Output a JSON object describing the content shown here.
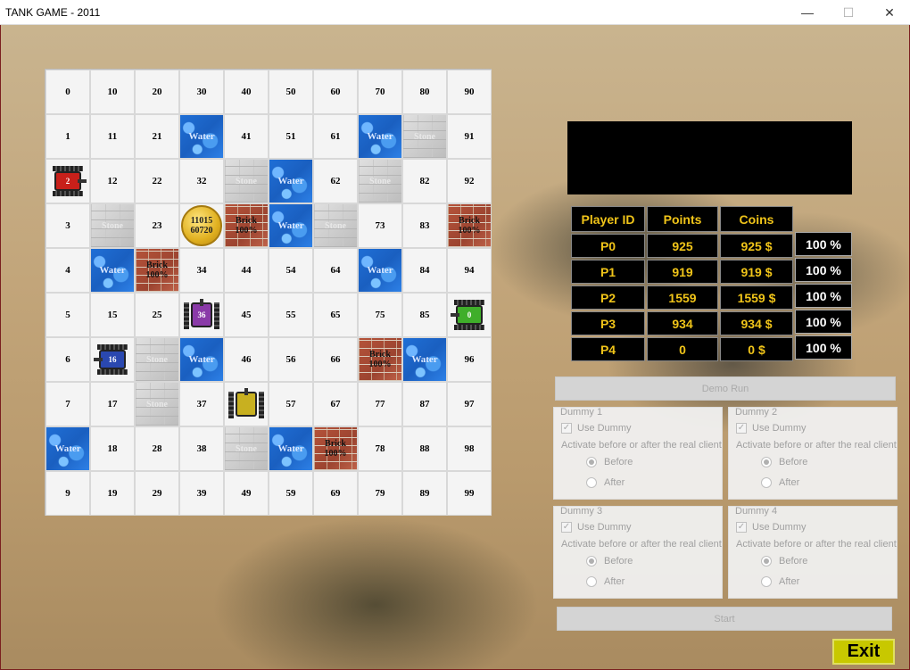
{
  "window": {
    "title": "TANK GAME - 2011",
    "min": "—",
    "max": "☐",
    "close": "✕"
  },
  "board": {
    "cells": [
      [
        "0",
        "10",
        "20",
        "30",
        "40",
        "50",
        "60",
        "70",
        "80",
        "90"
      ],
      [
        "1",
        "11",
        "21",
        "Water",
        "41",
        "51",
        "61",
        "Water",
        "Stone",
        "91"
      ],
      [
        "TANK:2:red:right",
        "12",
        "22",
        "32",
        "Stone",
        "Water",
        "62",
        "Stone",
        "82",
        "92"
      ],
      [
        "3",
        "Stone",
        "23",
        "COIN:11015:60720",
        "Brick:100%",
        "Water",
        "Stone",
        "73",
        "83",
        "Brick:100%"
      ],
      [
        "4",
        "Water",
        "Brick:100%",
        "34",
        "44",
        "54",
        "64",
        "Water",
        "84",
        "94"
      ],
      [
        "5",
        "15",
        "25",
        "TANK:36:purple:up",
        "45",
        "55",
        "65",
        "75",
        "85",
        "TANK:0:green:left"
      ],
      [
        "6",
        "TANK:16:blue:left",
        "Stone",
        "Water",
        "46",
        "56",
        "66",
        "Brick:100%",
        "Water",
        "96"
      ],
      [
        "7",
        "17",
        "Stone",
        "37",
        "TANK:?:yellow:up",
        "57",
        "67",
        "77",
        "87",
        "97"
      ],
      [
        "Water",
        "18",
        "28",
        "38",
        "Stone",
        "Water",
        "Brick:100%",
        "78",
        "88",
        "98"
      ],
      [
        "9",
        "19",
        "29",
        "39",
        "49",
        "59",
        "69",
        "79",
        "89",
        "99"
      ]
    ]
  },
  "scoreboard": {
    "headers": {
      "id": "Player ID",
      "points": "Points",
      "coins": "Coins"
    },
    "rows": [
      {
        "id": "P0",
        "points": "925",
        "coins": "925 $",
        "health": "100 %"
      },
      {
        "id": "P1",
        "points": "919",
        "coins": "919 $",
        "health": "100 %"
      },
      {
        "id": "P2",
        "points": "1559",
        "coins": "1559 $",
        "health": "100 %"
      },
      {
        "id": "P3",
        "points": "934",
        "coins": "934 $",
        "health": "100 %"
      },
      {
        "id": "P4",
        "points": "0",
        "coins": "0 $",
        "health": "100 %"
      }
    ]
  },
  "controls": {
    "demo_run": "Demo Run",
    "use_dummy": "Use Dummy",
    "activate": "Activate before or after the real client",
    "before": "Before",
    "after": "After",
    "dummies": [
      "Dummy 1",
      "Dummy 2",
      "Dummy 3",
      "Dummy 4"
    ],
    "start": "Start",
    "exit": "Exit"
  },
  "colors": {
    "exit_bg": "#c8c800",
    "score_text": "#f0c419",
    "water": "#1f6fd6",
    "brick": "#b5533a"
  }
}
